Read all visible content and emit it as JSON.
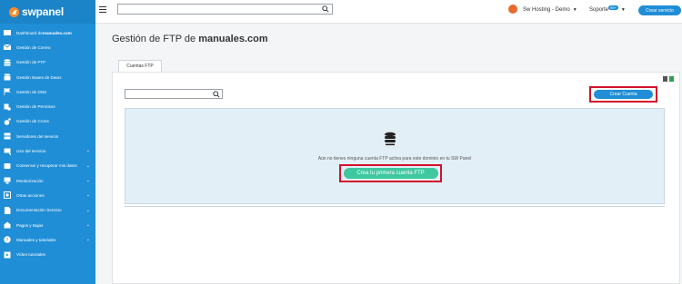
{
  "brand": {
    "name": "swpanel"
  },
  "sidebar": {
    "items": [
      {
        "label": "Dashboard de ",
        "bold": "manuales.com",
        "icon": "dashboard-icon",
        "chevron": false
      },
      {
        "label": "Gestión de Correo",
        "icon": "mail-icon",
        "chevron": false
      },
      {
        "label": "Gestión de FTP",
        "icon": "database-icon",
        "chevron": false
      },
      {
        "label": "Gestión Bases de Datos",
        "icon": "database-stack-icon",
        "chevron": false
      },
      {
        "label": "Gestión de DNS",
        "icon": "flag-icon",
        "chevron": false
      },
      {
        "label": "Gestión de Permisos",
        "icon": "permissions-icon",
        "chevron": false
      },
      {
        "label": "Gestión de Crons",
        "icon": "cron-gear-icon",
        "chevron": false
      },
      {
        "label": "Servidores del servicio",
        "icon": "server-icon",
        "chevron": false
      },
      {
        "label": "Uso del servicio",
        "icon": "usage-icon",
        "chevron": true
      },
      {
        "label": "Conservar y recuperar mis datos",
        "icon": "backup-icon",
        "chevron": true
      },
      {
        "label": "Monitorización",
        "icon": "monitor-icon",
        "chevron": true
      },
      {
        "label": "Otras acciones",
        "icon": "actions-icon",
        "chevron": true
      },
      {
        "label": "Documentación Servicio",
        "icon": "document-icon",
        "chevron": true
      },
      {
        "label": "Pagos y Bajas",
        "icon": "payments-icon",
        "chevron": true
      },
      {
        "label": "Manuales y tutoriales",
        "icon": "help-icon",
        "chevron": true
      },
      {
        "label": "Vídeo tutoriales",
        "icon": "video-icon",
        "chevron": false
      }
    ]
  },
  "topbar": {
    "search_placeholder": "",
    "user_name": "Sw Hosting - Demo",
    "support_label": "Soporte",
    "support_badge": "99+",
    "create_service_label": "Crear servicio"
  },
  "main": {
    "title_prefix": "Gestión de FTP de ",
    "title_domain": "manuales.com",
    "tab_label": "Cuentas FTP",
    "create_account_label": "Crear Cuenta",
    "empty_message": "Aún no tienes ninguna cuenta FTP activa para este dominio en tu SW Panel",
    "first_account_label": "Crea tu primera cuenta FTP"
  },
  "colors": {
    "sidebar": "#1f8ed6",
    "accent": "#1f8ed6",
    "highlight": "#d0112b",
    "cta_green": "#3fc8a0"
  }
}
